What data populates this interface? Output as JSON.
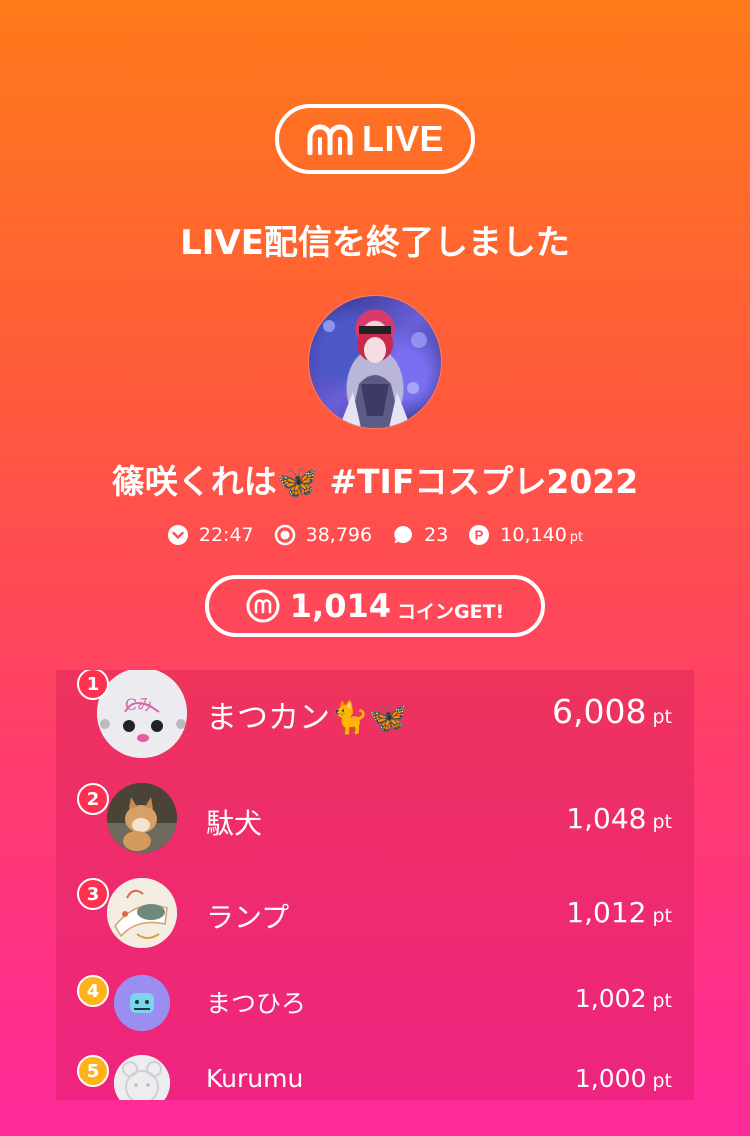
{
  "header": {
    "logo_text": "LIVE"
  },
  "title": "LIVE配信を終了しました",
  "channel_name": "篠咲くれは🦋 #TIFコスプレ2022",
  "stats": {
    "duration": "22:47",
    "viewers": "38,796",
    "comments": "23",
    "points": "10,140",
    "points_unit": "pt"
  },
  "coins": {
    "amount": "1,014",
    "suffix": "コインGET!"
  },
  "ranking": [
    {
      "rank": "1",
      "name": "まつカン🐈🦋",
      "points": "6,008",
      "unit": "pt"
    },
    {
      "rank": "2",
      "name": "駄犬",
      "points": "1,048",
      "unit": "pt"
    },
    {
      "rank": "3",
      "name": "ランプ",
      "points": "1,012",
      "unit": "pt"
    },
    {
      "rank": "4",
      "name": "まつひろ",
      "points": "1,002",
      "unit": "pt"
    },
    {
      "rank": "5",
      "name": "Kurumu",
      "points": "1,000",
      "unit": "pt"
    }
  ],
  "colors": {
    "badge_red": "#ff3050",
    "badge_gold": "#ffb21a"
  }
}
